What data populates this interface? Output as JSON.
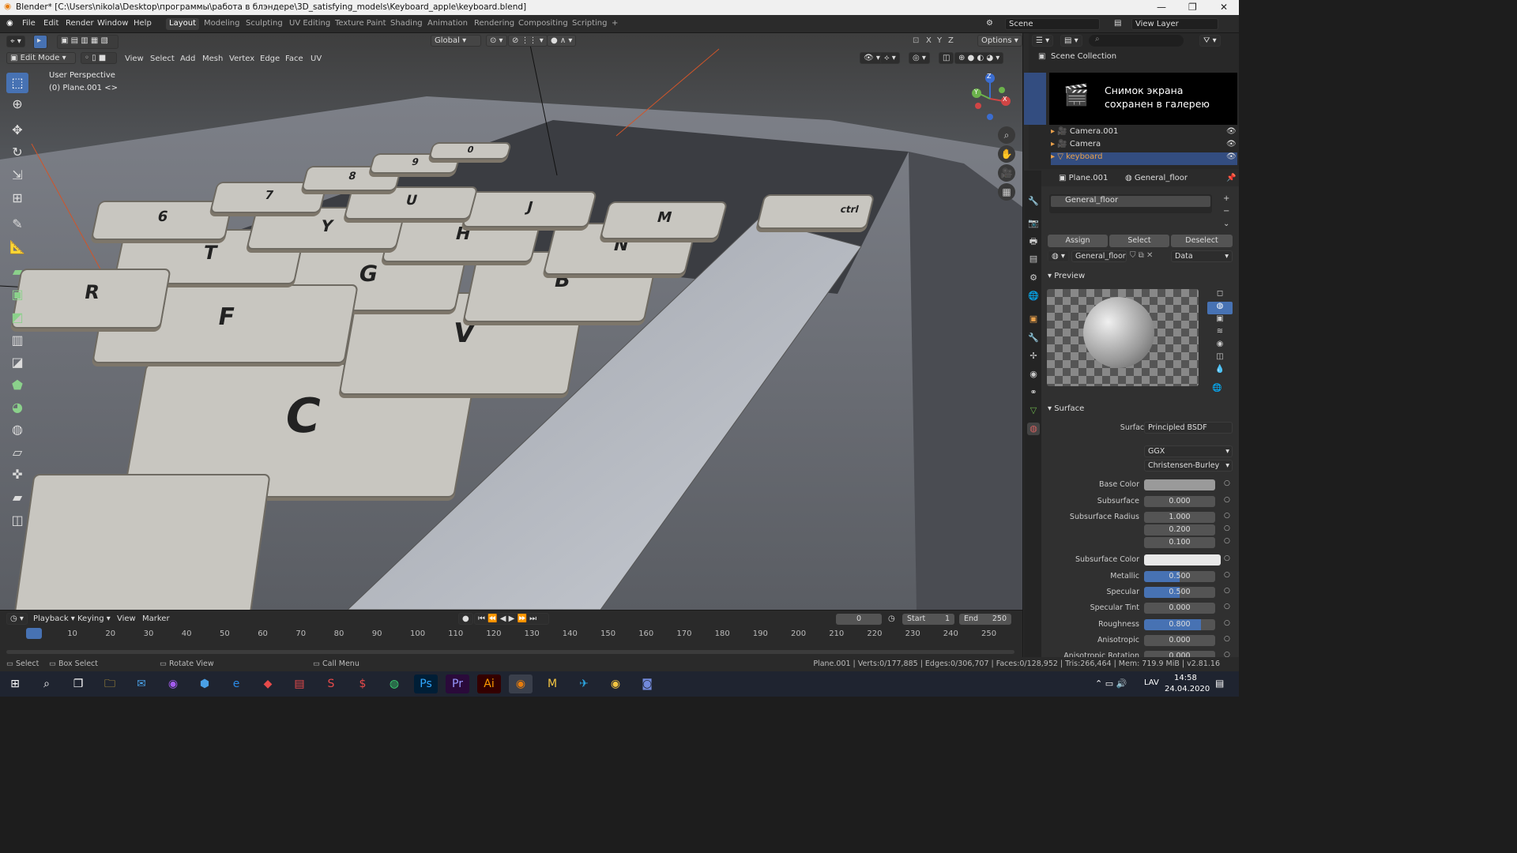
{
  "window": {
    "title": "Blender* [C:\\Users\\nikola\\Desktop\\программы\\работа в блэндере\\3D_satisfying_models\\Keyboard_apple\\keyboard.blend]",
    "controls": [
      "—",
      "❐",
      "✕"
    ]
  },
  "menu": {
    "items": [
      "File",
      "Edit",
      "Render",
      "Window",
      "Help"
    ]
  },
  "workspaces": {
    "tabs": [
      "Layout",
      "Modeling",
      "Sculpting",
      "UV Editing",
      "Texture Paint",
      "Shading",
      "Animation",
      "Rendering",
      "Compositing",
      "Scripting"
    ],
    "active": "Layout",
    "add": "+"
  },
  "scene": {
    "label": "Scene",
    "view_layer": "View Layer"
  },
  "viewport_header": {
    "mode": "Edit Mode",
    "menus": [
      "View",
      "Select",
      "Add",
      "Mesh",
      "Vertex",
      "Edge",
      "Face",
      "UV"
    ],
    "transform": "Global",
    "axes": [
      "X",
      "Y",
      "Z"
    ],
    "options": "Options"
  },
  "viewport": {
    "perspective": "User Perspective",
    "object": "(0) Plane.001 <>"
  },
  "keys": [
    "C",
    "V",
    "B",
    "N",
    "M",
    "G",
    "H",
    "J",
    "F",
    "T",
    "Y",
    "U",
    "6",
    "7",
    "8",
    "9",
    "0",
    "R",
    "ctrl"
  ],
  "gizmo": {
    "x": "X",
    "y": "Y",
    "z": "Z"
  },
  "outliner": {
    "title": "Scene Collection",
    "items": [
      "Camera.001",
      "Camera",
      "keyboard"
    ]
  },
  "toast": {
    "text": "Снимок экрана сохранен в галерею"
  },
  "properties": {
    "object": "Plane.001",
    "material": "General_floor",
    "slot": "General_floor",
    "buttons": [
      "Assign",
      "Select",
      "Deselect"
    ],
    "mat_name": "General_floor",
    "data": "Data",
    "preview_label": "Preview",
    "surface_label": "Surface",
    "surface_shader": "Principled BSDF",
    "dist": "GGX",
    "subsurface_method": "Christensen-Burley",
    "fields": [
      {
        "label": "Surface",
        "value": "Principled BSDF"
      },
      {
        "label": "Base Color",
        "value": ""
      },
      {
        "label": "Subsurface",
        "value": "0.000"
      },
      {
        "label": "Subsurface Radius",
        "value": "1.000"
      },
      {
        "label": "",
        "value": "0.200"
      },
      {
        "label": "",
        "value": "0.100"
      },
      {
        "label": "Subsurface Color",
        "value": ""
      },
      {
        "label": "Metallic",
        "value": "0.500",
        "fill": 0.5
      },
      {
        "label": "Specular",
        "value": "0.500",
        "fill": 0.5
      },
      {
        "label": "Specular Tint",
        "value": "0.000"
      },
      {
        "label": "Roughness",
        "value": "0.800",
        "fill": 0.8
      },
      {
        "label": "Anisotropic",
        "value": "0.000"
      },
      {
        "label": "Anisotropic Rotation",
        "value": "0.000"
      }
    ]
  },
  "timeline": {
    "menus": [
      "Playback",
      "Keying",
      "View",
      "Marker"
    ],
    "current": "0",
    "start_label": "Start",
    "start": "1",
    "end_label": "End",
    "end": "250",
    "ticks": [
      "0",
      "10",
      "20",
      "30",
      "40",
      "50",
      "60",
      "70",
      "80",
      "90",
      "100",
      "110",
      "120",
      "130",
      "140",
      "150",
      "160",
      "170",
      "180",
      "190",
      "200",
      "210",
      "220",
      "230",
      "240",
      "250"
    ]
  },
  "status": {
    "select": "Select",
    "box": "Box Select",
    "rotate": "Rotate View",
    "call": "Call Menu",
    "info": "Plane.001 | Verts:0/177,885 | Edges:0/306,707 | Faces:0/128,952 | Tris:266,464 | Mem: 719.9 MiB | v2.81.16"
  },
  "taskbar": {
    "lang": "LAV",
    "time": "14:58",
    "date": "24.04.2020"
  }
}
